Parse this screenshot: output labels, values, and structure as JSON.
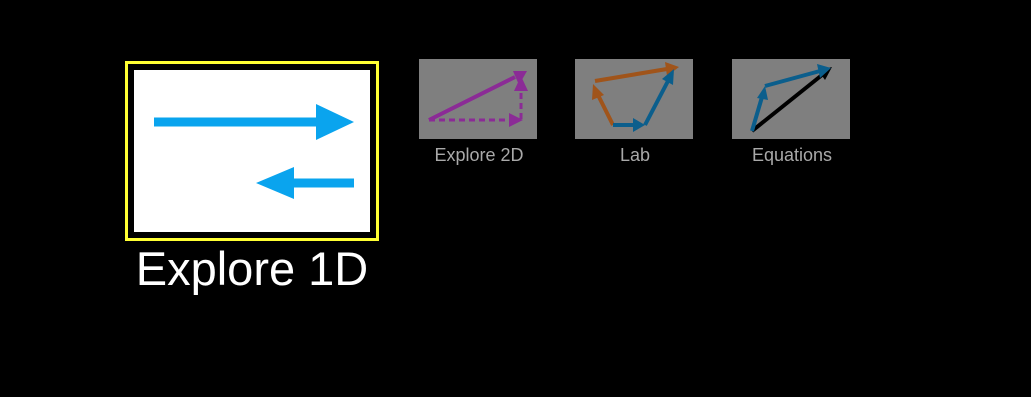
{
  "screens": [
    {
      "label": "Explore 1D",
      "icon": "explore-1d-icon",
      "selected": true
    },
    {
      "label": "Explore 2D",
      "icon": "explore-2d-icon",
      "selected": false
    },
    {
      "label": "Lab",
      "icon": "lab-icon",
      "selected": false
    },
    {
      "label": "Equations",
      "icon": "equations-icon",
      "selected": false
    }
  ],
  "colors": {
    "background": "#000000",
    "selected_border": "#ffff33",
    "thumbnail_bg": "#7f7f7f",
    "label_inactive": "#a9a9a9",
    "vector_blue": "#0aa4ee",
    "vector_purple": "#8b2b96",
    "vector_orange": "#a0541a",
    "vector_teal": "#0b5e8c"
  }
}
